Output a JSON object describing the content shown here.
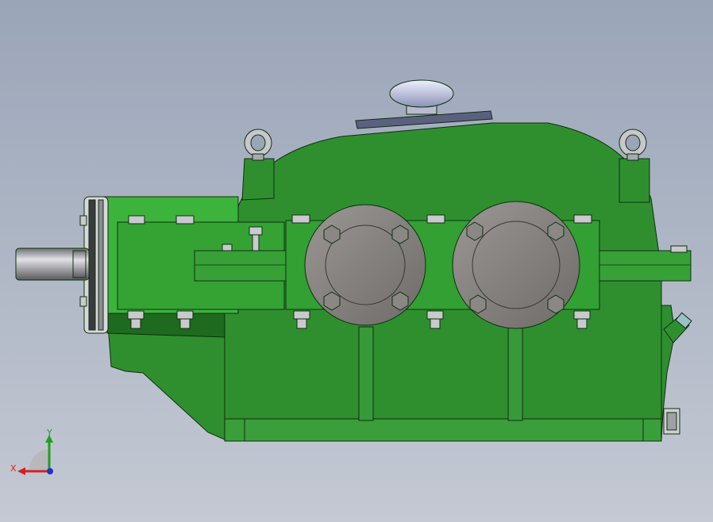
{
  "viewport": {
    "background_top": "#9aa5b8",
    "background_bottom": "#c4c9d3"
  },
  "model": {
    "housing_color": "#2e8b2e",
    "housing_light": "#3fb03f",
    "housing_dark": "#1f6b1f",
    "cap_color": "#7e7b78",
    "steel_color": "#b7b7bb"
  },
  "triad": {
    "x_label": "X",
    "y_label": "Y",
    "x_color": "#d42020",
    "y_color": "#20a020",
    "z_color": "#2030d0"
  }
}
